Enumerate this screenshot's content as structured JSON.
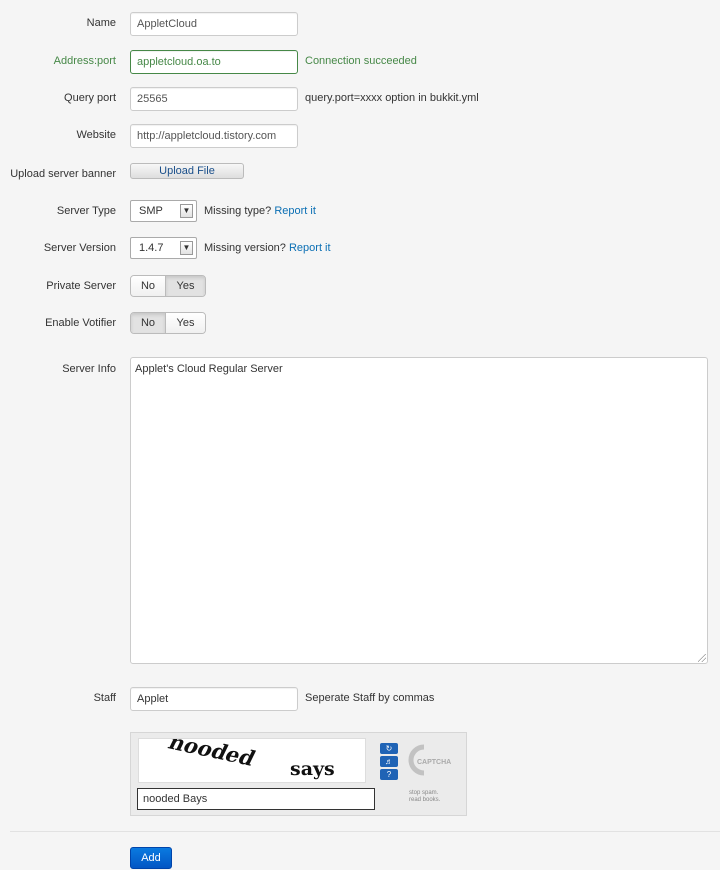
{
  "form": {
    "name": {
      "label": "Name",
      "value": "AppletCloud"
    },
    "address": {
      "label": "Address:port",
      "value": "appletcloud.oa.to",
      "status": "Connection succeeded"
    },
    "query_port": {
      "label": "Query port",
      "value": "25565",
      "help": "query.port=xxxx option in bukkit.yml"
    },
    "website": {
      "label": "Website",
      "value": "http://appletcloud.tistory.com"
    },
    "banner": {
      "label": "Upload server banner",
      "button": "Upload File"
    },
    "server_type": {
      "label": "Server Type",
      "selected": "SMP",
      "help_text": "Missing type?",
      "help_link": "Report it"
    },
    "server_version": {
      "label": "Server Version",
      "selected": "1.4.7",
      "help_text": "Missing version?",
      "help_link": "Report it"
    },
    "private_server": {
      "label": "Private Server",
      "options": [
        "No",
        "Yes"
      ],
      "active": "Yes"
    },
    "votifier": {
      "label": "Enable Votifier",
      "options": [
        "No",
        "Yes"
      ],
      "active": "No"
    },
    "server_info": {
      "label": "Server Info",
      "value": "Applet's Cloud Regular Server"
    },
    "staff": {
      "label": "Staff",
      "value": "Applet",
      "help": "Seperate Staff by commas"
    },
    "captcha": {
      "word1": "nooded",
      "word2": "says",
      "response": "nooded Bays",
      "logo": "CAPTCHA",
      "tagline_1": "stop spam.",
      "tagline_2": "read books."
    },
    "submit": "Add"
  },
  "colors": {
    "success": "#468847",
    "link": "#0b6fb4",
    "primary": "#0356c4"
  }
}
